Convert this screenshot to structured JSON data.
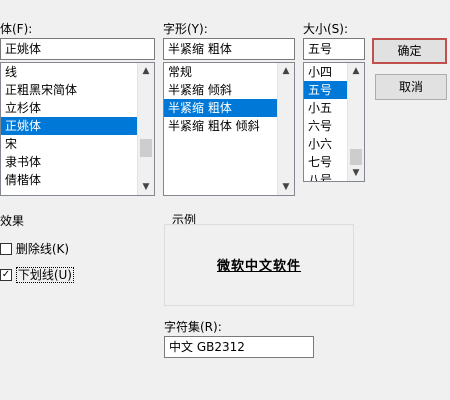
{
  "font": {
    "label": "体(F):",
    "value": "正姚体",
    "items": [
      {
        "text": "线",
        "selected": false
      },
      {
        "text": "正粗黑宋简体",
        "selected": false
      },
      {
        "text": "立杉体",
        "selected": false
      },
      {
        "text": "正姚体",
        "selected": true
      },
      {
        "text": "宋",
        "selected": false
      },
      {
        "text": "隶书体",
        "selected": false
      },
      {
        "text": "倩楷体",
        "selected": false
      }
    ]
  },
  "style": {
    "label": "字形(Y):",
    "value": "半紧缩 粗体",
    "items": [
      {
        "text": "常规",
        "selected": false
      },
      {
        "text": "半紧缩 倾斜",
        "selected": false
      },
      {
        "text": "半紧缩 粗体",
        "selected": true
      },
      {
        "text": "半紧缩 粗体 倾斜",
        "selected": false
      }
    ]
  },
  "size": {
    "label": "大小(S):",
    "value": "五号",
    "items": [
      {
        "text": "小四",
        "selected": false
      },
      {
        "text": "五号",
        "selected": true
      },
      {
        "text": "小五",
        "selected": false
      },
      {
        "text": "六号",
        "selected": false
      },
      {
        "text": "小六",
        "selected": false
      },
      {
        "text": "七号",
        "selected": false
      },
      {
        "text": "八号",
        "selected": false
      }
    ]
  },
  "buttons": {
    "ok": "确定",
    "cancel": "取消"
  },
  "effects": {
    "label": "效果",
    "strikeout": {
      "label": "删除线(K)",
      "checked": false
    },
    "underline": {
      "label": "下划线(U)",
      "checked": true
    }
  },
  "sample": {
    "label": "示例",
    "text": "微软中文软件"
  },
  "charset": {
    "label": "字符集(R):",
    "value": "中文 GB2312"
  }
}
